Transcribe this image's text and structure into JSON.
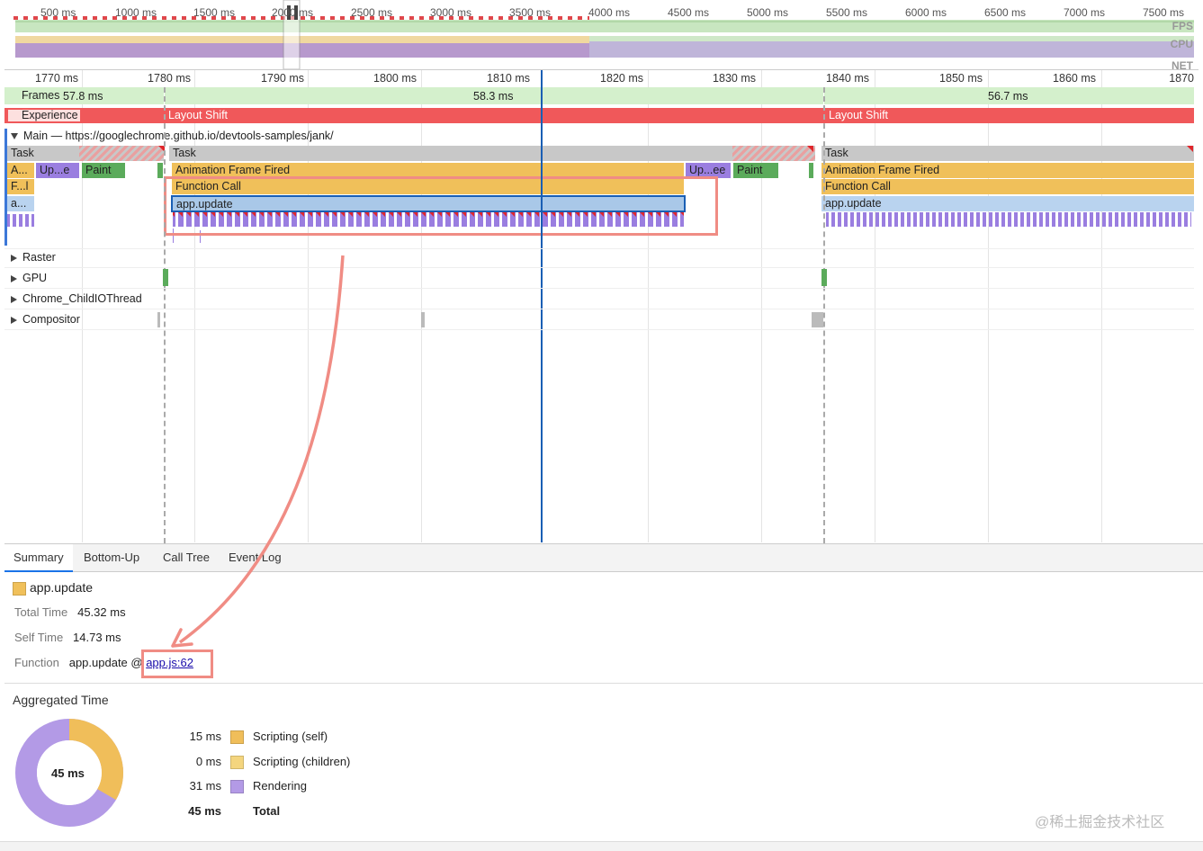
{
  "overview": {
    "ticks": [
      "500 ms",
      "1000 ms",
      "1500 ms",
      "2000 ms",
      "2500 ms",
      "3000 ms",
      "3500 ms",
      "4000 ms",
      "4500 ms",
      "5000 ms",
      "5500 ms",
      "6000 ms",
      "6500 ms",
      "7000 ms",
      "7500 ms"
    ],
    "labels": {
      "fps": "FPS",
      "cpu": "CPU",
      "net": "NET"
    }
  },
  "ruler": {
    "ticks": [
      "1770 ms",
      "1780 ms",
      "1790 ms",
      "1800 ms",
      "1810 ms",
      "1820 ms",
      "1830 ms",
      "1840 ms",
      "1850 ms",
      "1860 ms",
      "1870"
    ]
  },
  "frames": {
    "label": "Frames",
    "values": [
      "57.8 ms",
      "58.3 ms",
      "56.7 ms"
    ]
  },
  "experience": {
    "label": "Experience",
    "events": [
      "Layout Shift",
      "Layout Shift"
    ]
  },
  "main": {
    "label": "Main — https://googlechrome.github.io/devtools-samples/jank/"
  },
  "flame": {
    "task": "Task",
    "left_row2": [
      "A...",
      "Up...e",
      "Paint"
    ],
    "left_row3": "F...l",
    "left_row4": "a...",
    "animation_frame": "Animation Frame Fired",
    "function_call": "Function Call",
    "app_update": "app.update",
    "mid_update": "Up...ee",
    "mid_paint": "Paint"
  },
  "threads": [
    "Raster",
    "GPU",
    "Chrome_ChildIOThread",
    "Compositor"
  ],
  "tabs": [
    "Summary",
    "Bottom-Up",
    "Call Tree",
    "Event Log"
  ],
  "summary": {
    "title": "app.update",
    "color": "#f0c05a",
    "total_time_label": "Total Time",
    "total_time": "45.32 ms",
    "self_time_label": "Self Time",
    "self_time": "14.73 ms",
    "function_label": "Function",
    "function_name": "app.update @ ",
    "function_link": "app.js:62"
  },
  "aggregated": {
    "title": "Aggregated Time",
    "center": "45 ms",
    "rows": [
      {
        "value": "15 ms",
        "label": "Scripting (self)",
        "color": "#f0be5a"
      },
      {
        "value": "0 ms",
        "label": "Scripting (children)",
        "color": "#f4d57e"
      },
      {
        "value": "31 ms",
        "label": "Rendering",
        "color": "#b39ae6"
      }
    ],
    "total_value": "45 ms",
    "total_label": "Total"
  },
  "watermark": "@稀土掘金技术社区"
}
